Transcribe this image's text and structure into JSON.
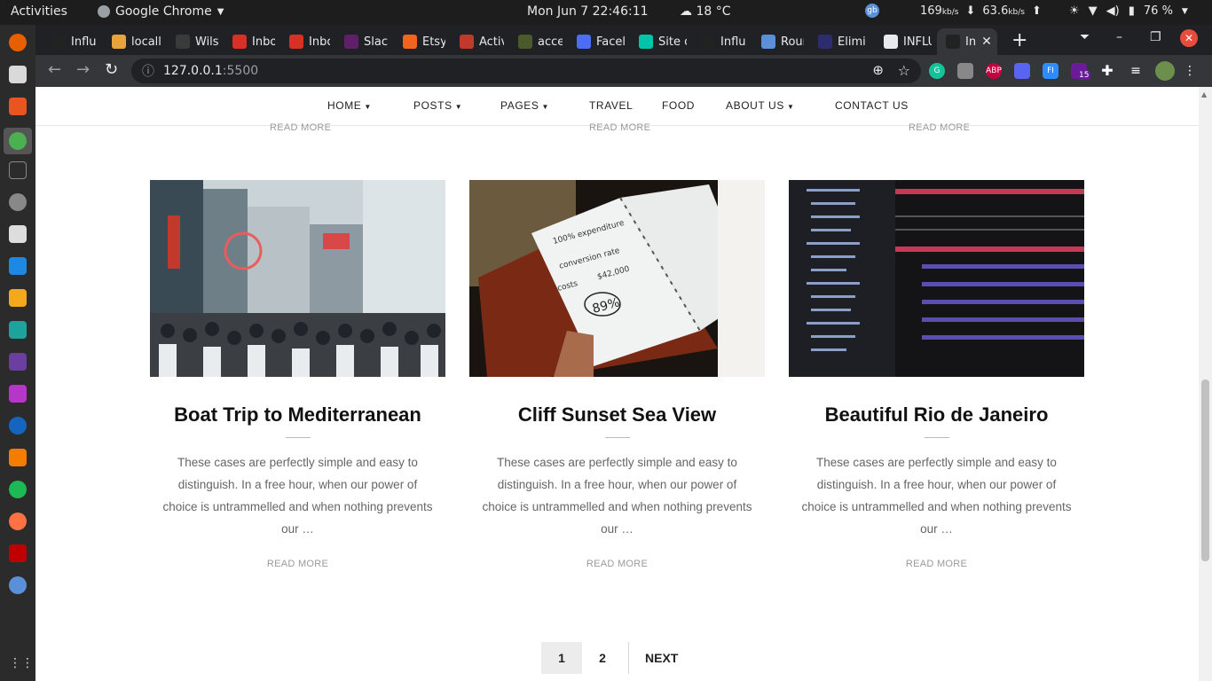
{
  "topbar": {
    "activities": "Activities",
    "app_name": "Google Chrome",
    "clock": "Mon Jun 7  22:46:11",
    "weather": "18 °C",
    "net_down": "169",
    "net_down_unit": "kb/s",
    "net_up": "63.6",
    "net_up_unit": "kb/s",
    "gb_badge": "gb",
    "battery": "76 %"
  },
  "tabs": [
    {
      "label": "Influ",
      "color": "#222222"
    },
    {
      "label": "locall",
      "color": "#e8a33d"
    },
    {
      "label": "Wilso",
      "color": "#3a3a3a"
    },
    {
      "label": "Inbox",
      "color": "#d93025"
    },
    {
      "label": "Inbox",
      "color": "#d93025"
    },
    {
      "label": "Slack",
      "color": "#611f69"
    },
    {
      "label": "Etsy",
      "color": "#f1641e"
    },
    {
      "label": "Activ",
      "color": "#c0392b"
    },
    {
      "label": "acce",
      "color": "#4a5a2a"
    },
    {
      "label": "Facel",
      "color": "#4c6ef5"
    },
    {
      "label": "Site c",
      "color": "#00c4a7"
    },
    {
      "label": "Influ",
      "color": "#222222"
    },
    {
      "label": "Rour",
      "color": "#5b8fd9"
    },
    {
      "label": "Elimi",
      "color": "#2c2c6e"
    },
    {
      "label": "INFLU",
      "color": "#e8eaed"
    },
    {
      "label": "In",
      "color": "#222222"
    }
  ],
  "toolbar": {
    "url_host": "127.0.0.1",
    "url_port": ":5500",
    "ext_abp": "ABP",
    "ext_fi": "FI",
    "ext_badge": "15"
  },
  "sitenav": {
    "items": [
      "HOME",
      "POSTS",
      "PAGES",
      "TRAVEL",
      "FOOD",
      "ABOUT US",
      "CONTACT US"
    ]
  },
  "prev_row_readmore": "READ MORE",
  "posts": [
    {
      "title": "Boat Trip to Mediterranean",
      "excerpt": "These cases are perfectly simple and easy to distin­guish. In a free hour, when our power of choice is untrammelled and when nothing prevents our …",
      "read_more": "READ MORE"
    },
    {
      "title": "Cliff Sunset Sea View",
      "excerpt": "These cases are perfectly simple and easy to distin­guish. In a free hour, when our power of choice is untrammelled and when nothing prevents our …",
      "read_more": "READ MORE",
      "image_text": {
        "a": "100% expenditure",
        "b": "conversion rate",
        "c": "costs",
        "d": "$42,000",
        "e": "89%"
      }
    },
    {
      "title": "Beautiful Rio de Janeiro",
      "excerpt": "These cases are perfectly simple and easy to distin­guish. In a free hour, when our power of choice is untrammelled and when nothing prevents our …",
      "read_more": "READ MORE"
    }
  ],
  "pagination": {
    "pages": [
      "1",
      "2"
    ],
    "current": "1",
    "next": "NEXT"
  }
}
